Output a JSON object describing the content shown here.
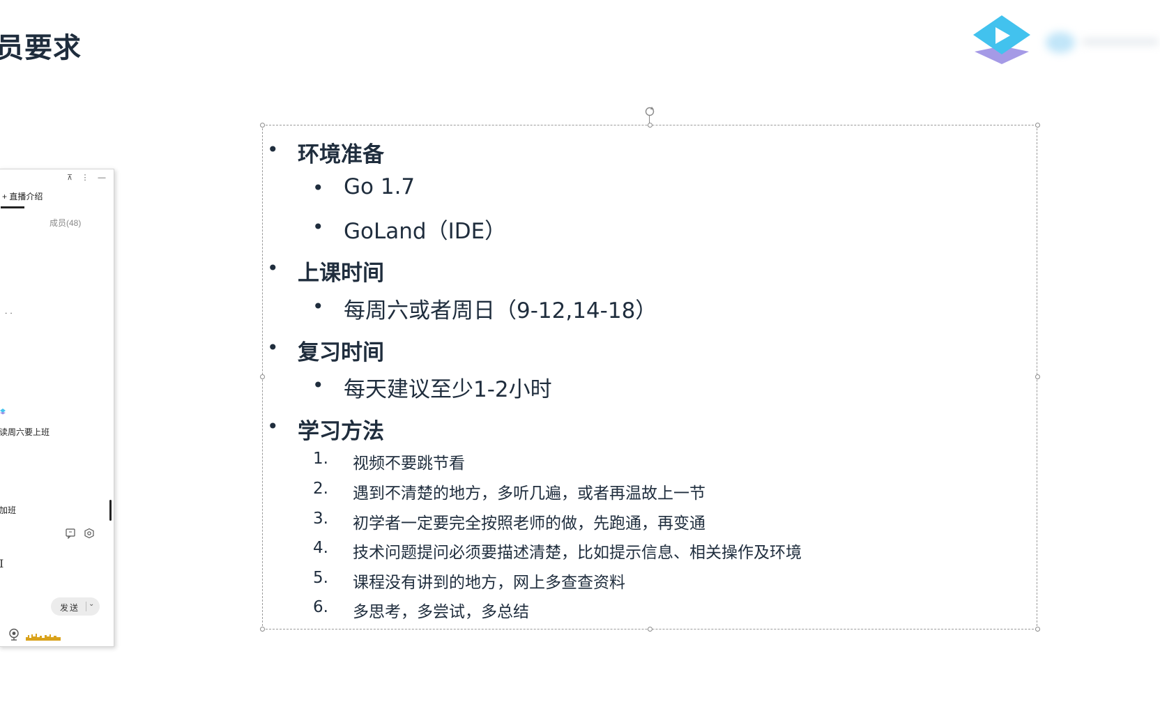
{
  "slide": {
    "title": "员要求",
    "sections": [
      {
        "heading": "环境准备",
        "items": [
          "Go 1.7",
          "GoLand（IDE）"
        ]
      },
      {
        "heading": "上课时间",
        "items": [
          "每周六或者周日（9-12,14-18）"
        ]
      },
      {
        "heading": "复习时间",
        "items": [
          "每天建议至少1-2小时"
        ]
      },
      {
        "heading": "学习方法",
        "numbered": [
          {
            "num": "1.",
            "text": "视频不要跳节看"
          },
          {
            "num": "2.",
            "text": "遇到不清楚的地方，多听几遍，或者再温故上一节"
          },
          {
            "num": "3.",
            "text": "初学者一定要完全按照老师的做，先跑通，再变通"
          },
          {
            "num": "4.",
            "text": "技术问题提问必须要描述清楚，比如提示信息、相关操作及环境"
          },
          {
            "num": "5.",
            "text": "课程没有讲到的地方，网上多查查资料"
          },
          {
            "num": "6.",
            "text": "多思考，多尝试，多总结"
          }
        ]
      }
    ],
    "bullet_char": "•"
  },
  "chat_panel": {
    "window_buttons": {
      "pin": "⊼",
      "more": "⋮",
      "minimize": "—"
    },
    "tab_live_intro": "+ 直播介绍",
    "members_label": "成员(48)",
    "ellipsis": "..",
    "messages": [
      "读周六要上班",
      "加班"
    ],
    "text_cursor": "I",
    "send_label": "发送",
    "send_caret": "⌄"
  },
  "colors": {
    "text": "#1f2d3d",
    "logo_top": "#46c3ef",
    "logo_bottom": "#8e8ee0",
    "audio_level": "#d9a21b"
  },
  "icons": {
    "logo": "play-logo-icon",
    "rotate": "rotate-handle-icon",
    "message_tool": "message-icon",
    "settings_tool": "hexagon-settings-icon",
    "camera": "camera-icon"
  }
}
